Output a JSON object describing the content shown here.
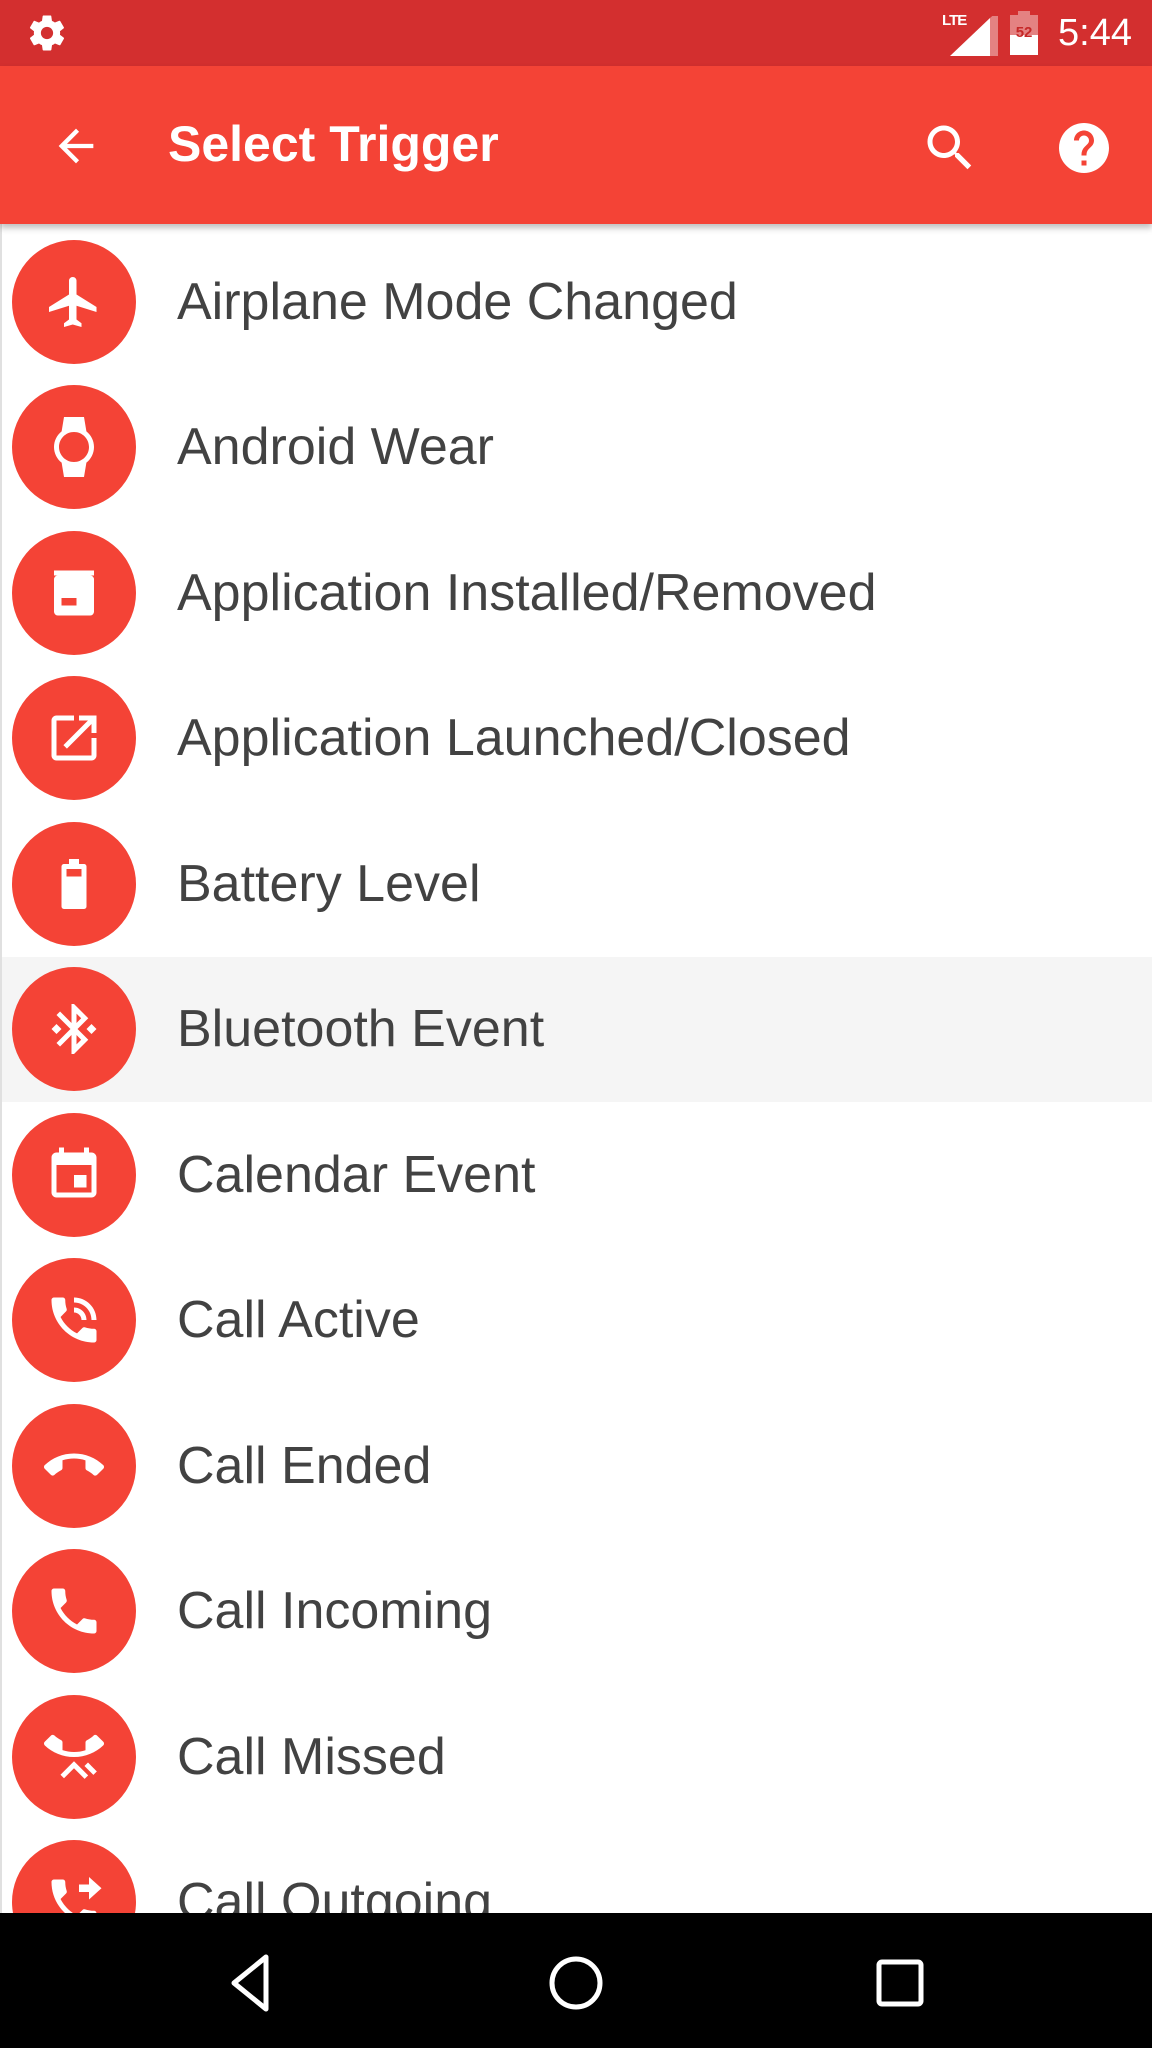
{
  "status_bar": {
    "network_label": "LTE",
    "battery_level": "52",
    "time": "5:44"
  },
  "toolbar": {
    "title": "Select Trigger",
    "back_icon": "arrow-back-icon",
    "search_icon": "search-icon",
    "help_icon": "help-icon"
  },
  "colors": {
    "status_bar": "#D32F2F",
    "toolbar": "#F44336",
    "icon_circle": "#F44336",
    "highlight_row": "#F5F5F5",
    "text": "#424242"
  },
  "triggers": [
    {
      "label": "Airplane Mode Changed",
      "icon": "airplane-icon"
    },
    {
      "label": "Android Wear",
      "icon": "watch-icon"
    },
    {
      "label": "Application Installed/Removed",
      "icon": "app-box-icon"
    },
    {
      "label": "Application Launched/Closed",
      "icon": "open-in-new-icon"
    },
    {
      "label": "Battery Level",
      "icon": "battery-icon"
    },
    {
      "label": "Bluetooth Event",
      "icon": "bluetooth-icon",
      "highlighted": true
    },
    {
      "label": "Calendar Event",
      "icon": "calendar-icon"
    },
    {
      "label": "Call Active",
      "icon": "phone-in-talk-icon"
    },
    {
      "label": "Call Ended",
      "icon": "call-end-icon"
    },
    {
      "label": "Call Incoming",
      "icon": "phone-icon"
    },
    {
      "label": "Call Missed",
      "icon": "call-missed-icon"
    },
    {
      "label": "Call Outgoing",
      "icon": "call-made-icon"
    }
  ],
  "nav_bar": {
    "back": "nav-back-icon",
    "home": "nav-home-icon",
    "recents": "nav-recents-icon"
  }
}
